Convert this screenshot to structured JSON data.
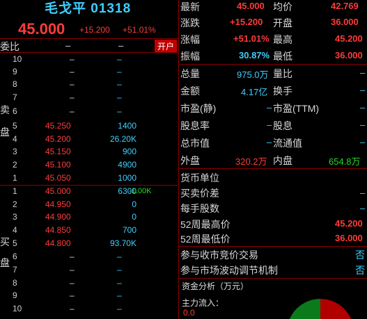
{
  "header": {
    "name": "毛戈平",
    "code": "01318",
    "price": "45.000",
    "change": "+15.200",
    "change_pct": "+51.01%"
  },
  "commission": {
    "label": "委比",
    "value1": "–",
    "value2": "–",
    "open_button": "开户"
  },
  "sell_side_label": [
    "卖",
    "盘"
  ],
  "buy_side_label": [
    "买",
    "盘"
  ],
  "asks": [
    {
      "level": "10",
      "price": "–",
      "volume": "–"
    },
    {
      "level": "9",
      "price": "–",
      "volume": "–"
    },
    {
      "level": "8",
      "price": "–",
      "volume": "–"
    },
    {
      "level": "7",
      "price": "–",
      "volume": "–"
    },
    {
      "level": "6",
      "price": "–",
      "volume": "–"
    },
    {
      "level": "5",
      "price": "45.250",
      "volume": "1400"
    },
    {
      "level": "4",
      "price": "45.200",
      "volume": "26.20K"
    },
    {
      "level": "3",
      "price": "45.150",
      "volume": "900"
    },
    {
      "level": "2",
      "price": "45.100",
      "volume": "4900"
    },
    {
      "level": "1",
      "price": "45.050",
      "volume": "1000"
    }
  ],
  "bids": [
    {
      "level": "1",
      "price": "45.000",
      "volume": "6300",
      "extra": "-1.00K"
    },
    {
      "level": "2",
      "price": "44.950",
      "volume": "0"
    },
    {
      "level": "3",
      "price": "44.900",
      "volume": "0"
    },
    {
      "level": "4",
      "price": "44.850",
      "volume": "700"
    },
    {
      "level": "5",
      "price": "44.800",
      "volume": "93.70K"
    },
    {
      "level": "6",
      "price": "–",
      "volume": "–"
    },
    {
      "level": "7",
      "price": "–",
      "volume": "–"
    },
    {
      "level": "8",
      "price": "–",
      "volume": "–"
    },
    {
      "level": "9",
      "price": "–",
      "volume": "–"
    },
    {
      "level": "10",
      "price": "–",
      "volume": "–"
    }
  ],
  "quote": {
    "latest_label": "最新",
    "latest": "45.000",
    "avg_label": "均价",
    "avg": "42.769",
    "change_label": "涨跌",
    "change": "+15.200",
    "open_label": "开盘",
    "open": "36.000",
    "pct_label": "涨幅",
    "pct": "+51.01%",
    "high_label": "最高",
    "high": "45.200",
    "amp_label": "振幅",
    "amp": "30.87%",
    "low_label": "最低",
    "low": "36.000",
    "vol_label": "总量",
    "vol": "975.0万",
    "vr_label": "量比",
    "vr": "–",
    "amt_label": "金额",
    "amt": "4.17亿",
    "turn_label": "换手",
    "turn": "–",
    "pe_static_label": "市盈(静)",
    "pe_static": "–",
    "pe_ttm_label": "市盈(TTM)",
    "pe_ttm": "–",
    "div_rate_label": "股息率",
    "div_rate": "–",
    "div_label": "股息",
    "div": "–",
    "mcap_label": "总市值",
    "mcap": "–",
    "float_label": "流通值",
    "float": "–",
    "outer_label": "外盘",
    "outer": "320.2万",
    "inner_label": "内盘",
    "inner": "654.8万"
  },
  "info": {
    "currency_label": "货币单位",
    "spread_label": "买卖价差",
    "spread": "–",
    "lot_label": "每手股数",
    "lot": "–",
    "w52h_label": "52周最高价",
    "w52h": "45.200",
    "w52l_label": "52周最低价",
    "w52l": "36.000",
    "cas_label": "参与收市竞价交易",
    "cas": "否",
    "vcm_label": "参与市场波动调节机制",
    "vcm": "否"
  },
  "funds": {
    "title": "资金分析（万元）",
    "inflow_label": "主力流入：",
    "inflow": "0.0"
  }
}
